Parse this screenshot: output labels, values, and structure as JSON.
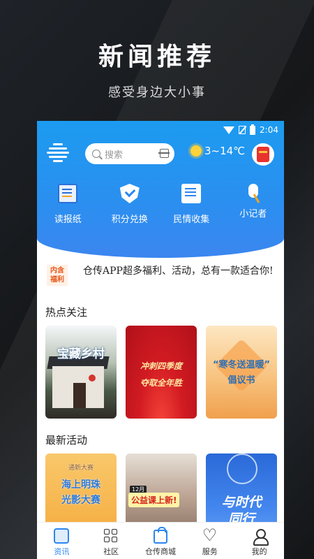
{
  "promo": {
    "title": "新闻推荐",
    "subtitle": "感受身边大小事"
  },
  "status_bar": {
    "time": "2:04"
  },
  "header": {
    "search_placeholder": "搜索",
    "weather": "3~14℃"
  },
  "nav": [
    {
      "label": "读报纸",
      "icon": "newspaper-icon"
    },
    {
      "label": "积分兑换",
      "icon": "shield-check-icon"
    },
    {
      "label": "民情收集",
      "icon": "document-icon"
    },
    {
      "label": "小记者",
      "icon": "microphone-icon"
    }
  ],
  "notice": {
    "badge_line1": "内含",
    "badge_line2": "福利",
    "text": "仓传APP超多福利、活动，总有一款适合你!"
  },
  "sections": {
    "hot": "热点关注",
    "activities": "最新活动"
  },
  "hot_cards": {
    "c1": "宝藏乡村",
    "c2_line1": "冲刺四季度",
    "c2_line2": "夺取全年胜",
    "c3_line1": "“寒冬送温暖”",
    "c3_line2": "倡议书"
  },
  "activity_cards": {
    "c4_small": "通新大赛",
    "c4_line1": "海上明珠",
    "c4_line2": "光影大赛",
    "c5_tag": "12月",
    "c5_banner": "公益课上新!",
    "c6_line1": "与时代",
    "c6_line2": "同行"
  },
  "tabbar": [
    {
      "label": "资讯",
      "icon": "home-icon",
      "active": true
    },
    {
      "label": "社区",
      "icon": "grid-icon",
      "active": false
    },
    {
      "label": "仓传商城",
      "icon": "shopping-bag-icon",
      "active": false
    },
    {
      "label": "服务",
      "icon": "heart-icon",
      "active": false
    },
    {
      "label": "我的",
      "icon": "user-icon",
      "active": false
    }
  ],
  "colors": {
    "accent": "#2b86ef",
    "hero": "#1c9bf0",
    "background": "#1a1c1f"
  }
}
